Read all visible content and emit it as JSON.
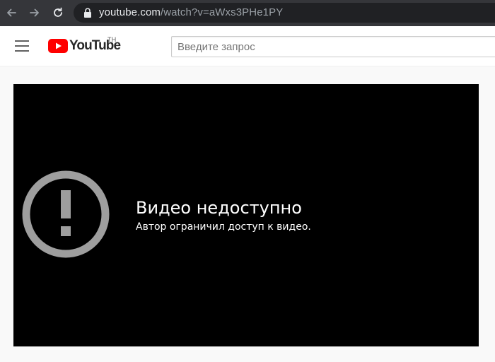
{
  "browser": {
    "url_host": "youtube.com",
    "url_path": "/watch?v=aWxs3PHe1PY"
  },
  "header": {
    "logo_text": "YouTube",
    "logo_country": "TH",
    "search_placeholder": "Введите запрос"
  },
  "player": {
    "error_title": "Видео недоступно",
    "error_subtitle": "Автор ограничил доступ к видео."
  },
  "colors": {
    "browser_bar": "#35363a",
    "omnibox": "#202124",
    "youtube_red": "#ff0000",
    "player_bg": "#000000",
    "error_icon": "#9e9e9e"
  }
}
